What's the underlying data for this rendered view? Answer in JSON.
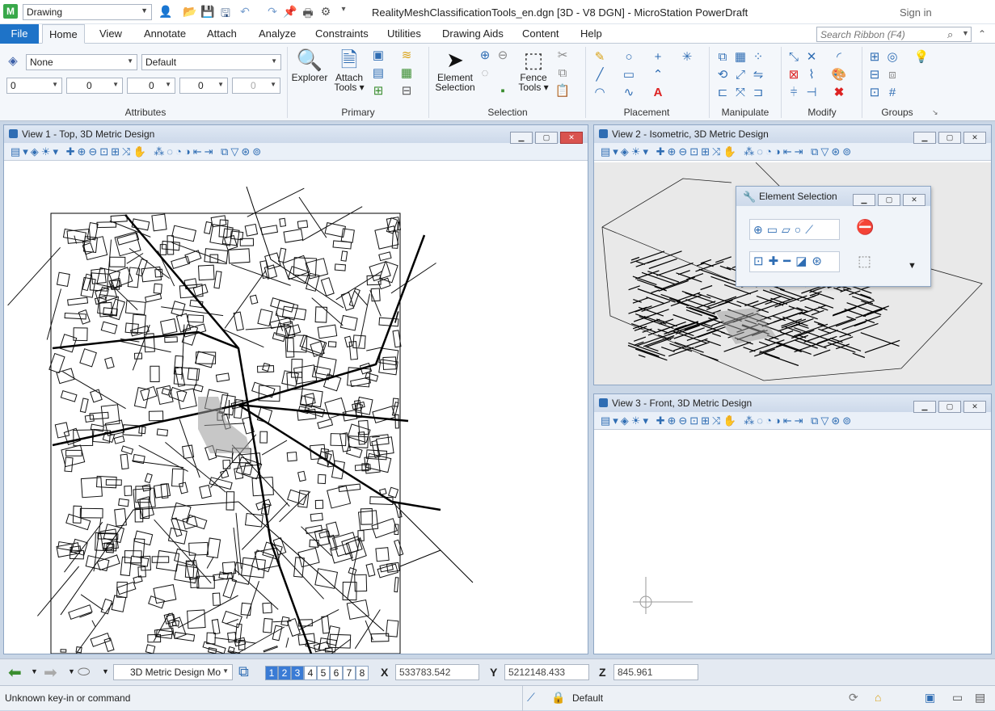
{
  "titlebar": {
    "app_icon": "M",
    "workspace": "Drawing",
    "document_title": "RealityMeshClassificationTools_en.dgn [3D - V8 DGN] - MicroStation PowerDraft",
    "sign_in": "Sign in"
  },
  "tabs": [
    "File",
    "Home",
    "View",
    "Annotate",
    "Attach",
    "Analyze",
    "Constraints",
    "Utilities",
    "Drawing Aids",
    "Content",
    "Help"
  ],
  "search": {
    "placeholder": "Search Ribbon (F4)"
  },
  "ribbon": {
    "attributes": {
      "level": "None",
      "style": "Default",
      "color": "0",
      "weight": "0",
      "line_style": "0",
      "transparency": "0",
      "priority": "0",
      "label": "Attributes"
    },
    "primary": {
      "explorer": "Explorer",
      "attach_tools_1": "Attach",
      "attach_tools_2": "Tools ▾",
      "label": "Primary"
    },
    "selection": {
      "element_selection_1": "Element",
      "element_selection_2": "Selection",
      "fence_tools_1": "Fence",
      "fence_tools_2": "Tools ▾",
      "label": "Selection"
    },
    "placement": {
      "label": "Placement"
    },
    "manipulate": {
      "label": "Manipulate"
    },
    "modify": {
      "label": "Modify"
    },
    "groups": {
      "label": "Groups"
    }
  },
  "views": {
    "view1": {
      "title": "View 1 - Top, 3D Metric Design"
    },
    "view2": {
      "title": "View 2 - Isometric, 3D Metric Design"
    },
    "view3": {
      "title": "View 3 - Front, 3D Metric Design"
    }
  },
  "element_selection": {
    "title": "Element Selection"
  },
  "bottombar": {
    "model": "3D Metric Design Mo",
    "view_numbers": [
      "1",
      "2",
      "3",
      "4",
      "5",
      "6",
      "7",
      "8"
    ],
    "x_label": "X",
    "x_value": "533783.542",
    "y_label": "Y",
    "y_value": "5212148.433",
    "z_label": "Z",
    "z_value": "845.961"
  },
  "statusbar": {
    "message": "Unknown key-in or command",
    "level": "Default"
  }
}
